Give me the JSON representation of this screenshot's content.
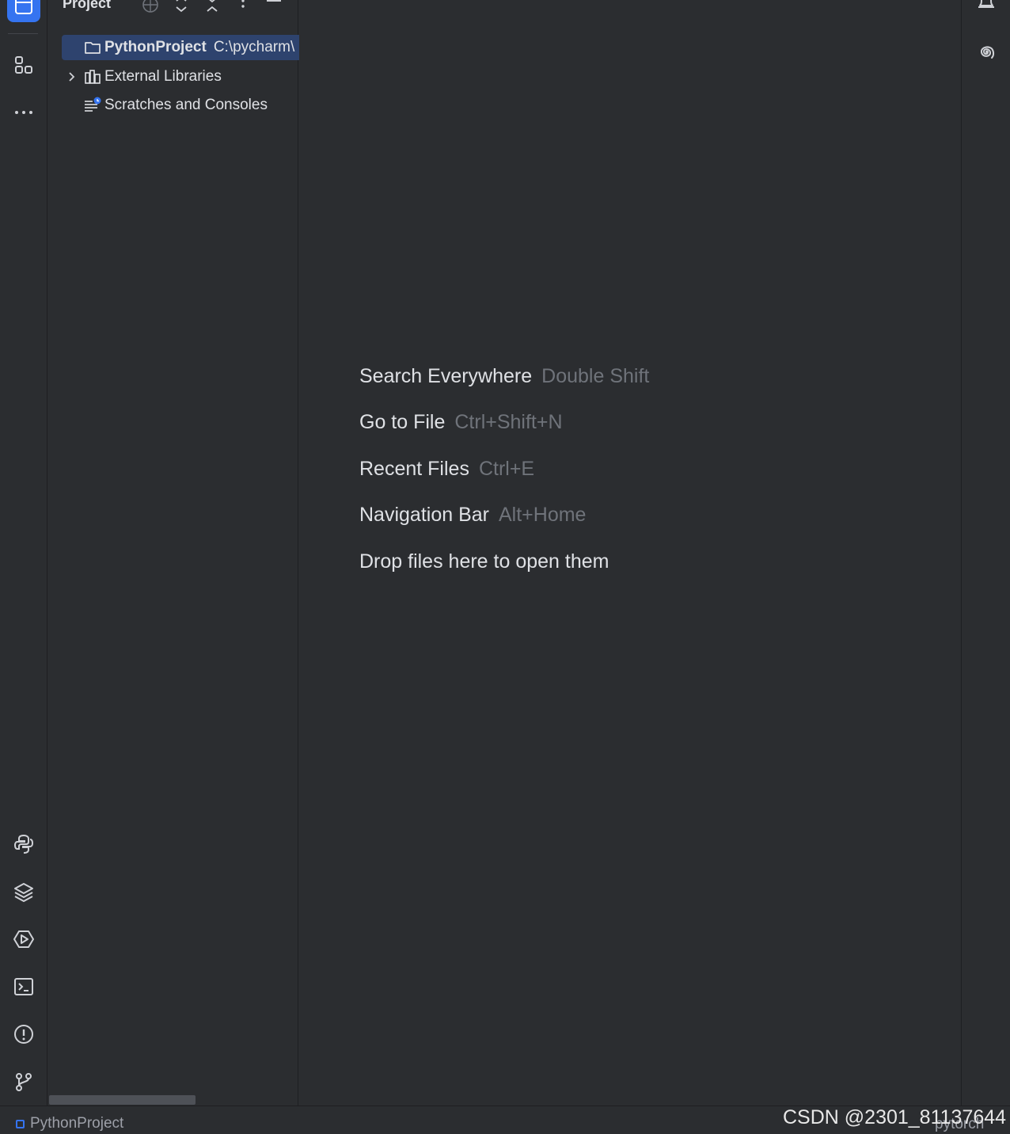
{
  "project_panel": {
    "title": "Project",
    "tree": [
      {
        "name": "PythonProject",
        "path": "C:\\pycharm\\",
        "selected": true
      },
      {
        "name": "External Libraries"
      },
      {
        "name": "Scratches and Consoles"
      }
    ]
  },
  "editor": {
    "hints": [
      {
        "action": "Search Everywhere",
        "shortcut": "Double Shift"
      },
      {
        "action": "Go to File",
        "shortcut": "Ctrl+Shift+N"
      },
      {
        "action": "Recent Files",
        "shortcut": "Ctrl+E"
      },
      {
        "action": "Navigation Bar",
        "shortcut": "Alt+Home"
      },
      {
        "action": "Drop files here to open them",
        "shortcut": ""
      }
    ]
  },
  "status_bar": {
    "project": "PythonProject",
    "interpreter": "pytorch"
  },
  "watermark": "CSDN @2301_81137644",
  "colors": {
    "accent": "#3574f0",
    "background": "#2b2d30",
    "selection": "#2e436e",
    "text": "#dfe1e5",
    "muted": "#6f737a"
  }
}
